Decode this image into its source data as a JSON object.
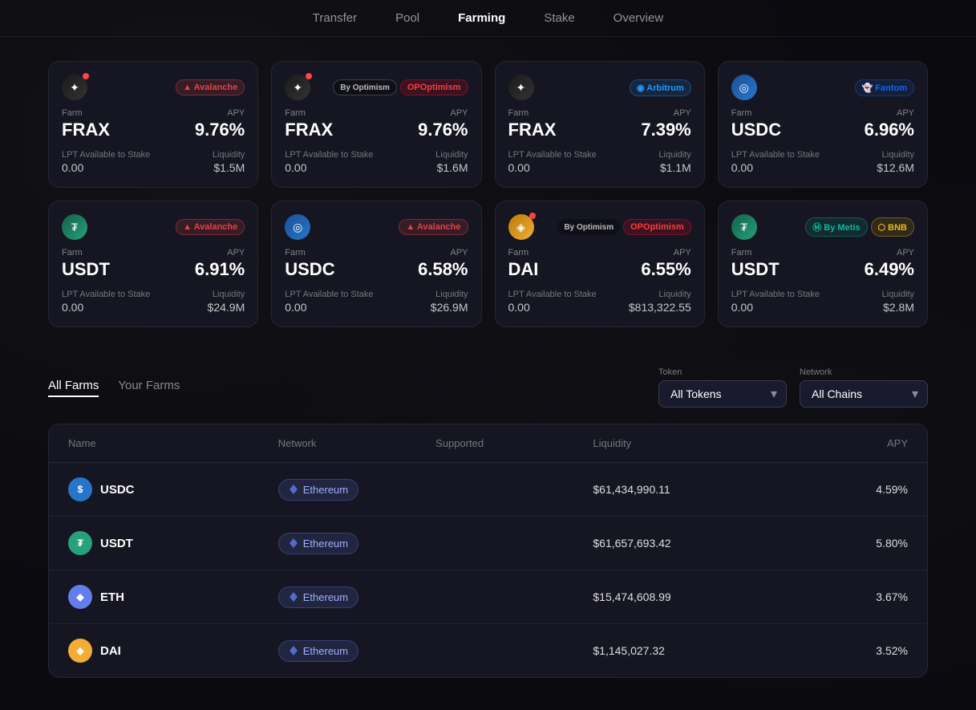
{
  "nav": {
    "items": [
      {
        "label": "Transfer",
        "active": false
      },
      {
        "label": "Pool",
        "active": false
      },
      {
        "label": "Farming",
        "active": true
      },
      {
        "label": "Stake",
        "active": false
      },
      {
        "label": "Overview",
        "active": false
      }
    ]
  },
  "topCards": [
    {
      "token": "FRAX",
      "apy": "9.76%",
      "lpt": "0.00",
      "liquidity": "$1.5M",
      "chain": "Avalanche",
      "chainType": "avalanche",
      "iconType": "frax",
      "hot": true
    },
    {
      "token": "FRAX",
      "apy": "9.76%",
      "lpt": "0.00",
      "liquidity": "$1.6M",
      "chain": "Optimism",
      "chainType": "optimism",
      "iconType": "frax",
      "hot": true,
      "byLabel": "By Optimism",
      "pillLabel": "OPOptimism"
    },
    {
      "token": "FRAX",
      "apy": "7.39%",
      "lpt": "0.00",
      "liquidity": "$1.1M",
      "chain": "Arbitrum",
      "chainType": "arbitrum",
      "iconType": "frax"
    },
    {
      "token": "USDC",
      "apy": "6.96%",
      "lpt": "0.00",
      "liquidity": "$12.6M",
      "chain": "Fantom",
      "chainType": "fantom",
      "iconType": "usdc"
    },
    {
      "token": "USDT",
      "apy": "6.91%",
      "lpt": "0.00",
      "liquidity": "$24.9M",
      "chain": "Avalanche",
      "chainType": "avalanche",
      "iconType": "usdt"
    },
    {
      "token": "USDC",
      "apy": "6.58%",
      "lpt": "0.00",
      "liquidity": "$26.9M",
      "chain": "Avalanche",
      "chainType": "avalanche",
      "iconType": "usdc"
    },
    {
      "token": "DAI",
      "apy": "6.55%",
      "lpt": "0.00",
      "liquidity": "$813,322.55",
      "chain": "Optimism",
      "chainType": "optimism",
      "iconType": "dai",
      "byLabel": "By Optimism",
      "pillLabel": "OPOptimism",
      "hot": true
    },
    {
      "token": "USDT",
      "apy": "6.49%",
      "lpt": "0.00",
      "liquidity": "$2.8M",
      "chain": "Metis/BNB",
      "chainType": "metis-bnb",
      "iconType": "usdt"
    }
  ],
  "tabs": {
    "all_farms": "All Farms",
    "your_farms": "Your Farms"
  },
  "filters": {
    "token_label": "Token",
    "token_value": "All Tokens",
    "network_label": "Network",
    "network_value": "All Chains"
  },
  "table": {
    "headers": [
      "Name",
      "Network",
      "Supported",
      "Liquidity",
      "APY"
    ],
    "rows": [
      {
        "token": "USDC",
        "iconType": "usdc",
        "network": "Ethereum",
        "supported": "",
        "liquidity": "$61,434,990.11",
        "apy": "4.59%"
      },
      {
        "token": "USDT",
        "iconType": "usdt",
        "network": "Ethereum",
        "supported": "",
        "liquidity": "$61,657,693.42",
        "apy": "5.80%"
      },
      {
        "token": "ETH",
        "iconType": "eth",
        "network": "Ethereum",
        "supported": "",
        "liquidity": "$15,474,608.99",
        "apy": "3.67%"
      },
      {
        "token": "DAI",
        "iconType": "dai",
        "network": "Ethereum",
        "supported": "",
        "liquidity": "$1,145,027.32",
        "apy": "3.52%"
      }
    ]
  },
  "icons": {
    "frax": "✦",
    "usdc": "◎",
    "usdt": "₮",
    "dai": "◈",
    "eth": "◆",
    "avalanche": "▲",
    "optimism": "●",
    "arbitrum": "◉",
    "fantom": "👻",
    "metis": "Ⓜ",
    "bnb": "⬡",
    "ethereum": "◆",
    "chevron_down": "▾"
  }
}
